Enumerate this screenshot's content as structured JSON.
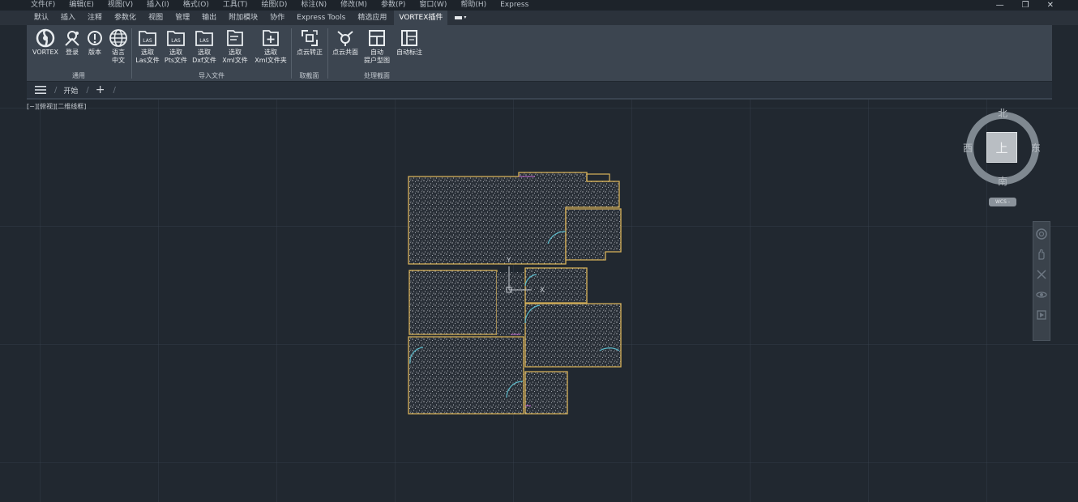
{
  "menu": [
    "文件(F)",
    "编辑(E)",
    "视图(V)",
    "插入(I)",
    "格式(O)",
    "工具(T)",
    "绘图(D)",
    "标注(N)",
    "修改(M)",
    "参数(P)",
    "窗口(W)",
    "帮助(H)",
    "Express"
  ],
  "window_controls": {
    "minimize": "—",
    "restore": "❐",
    "close": "✕"
  },
  "tabs": [
    "默认",
    "插入",
    "注释",
    "参数化",
    "视图",
    "管理",
    "输出",
    "附加模块",
    "协作",
    "Express Tools",
    "精选应用",
    "VORTEX插件"
  ],
  "active_tab": "VORTEX插件",
  "ribbon": {
    "groups": [
      {
        "title": "通用",
        "buttons": [
          {
            "label": "VORTEX",
            "icon": "vortex-logo-icon"
          },
          {
            "label": "登录",
            "icon": "login-icon"
          },
          {
            "label": "版本",
            "icon": "version-icon"
          },
          {
            "label": "语言\n中文",
            "icon": "globe-icon"
          }
        ]
      },
      {
        "title": "导入文件",
        "buttons": [
          {
            "label": "选取\nLas文件",
            "icon": "las-file-icon"
          },
          {
            "label": "选取\nPts文件",
            "icon": "pts-file-icon"
          },
          {
            "label": "选取\nDxf文件",
            "icon": "dxf-file-icon"
          },
          {
            "label": "选取\nXml文件",
            "icon": "xml-file-icon"
          },
          {
            "label": "选取\nXml文件夹",
            "icon": "xml-folder-icon"
          }
        ]
      },
      {
        "title": "取截面",
        "buttons": [
          {
            "label": "点云转正",
            "icon": "pointcloud-align-icon"
          }
        ]
      },
      {
        "title": "处理截面",
        "buttons": [
          {
            "label": "点云共面",
            "icon": "pointcloud-coplanar-icon"
          },
          {
            "label": "自动\n提户型图",
            "icon": "floorplan-icon"
          },
          {
            "label": "自动标注",
            "icon": "auto-dimension-icon"
          }
        ]
      }
    ]
  },
  "file_tabs": {
    "start": "开始",
    "add": "+"
  },
  "viewport": {
    "label": "[−][俯视][二维线框]",
    "compass": {
      "north": "北",
      "south": "南",
      "east": "东",
      "west": "西",
      "face": "上"
    },
    "wcs": "WCS -"
  },
  "colors": {
    "background": "#212830",
    "ribbon": "#3c4550",
    "wall": "#d9b35a",
    "door": "#5bb8c8"
  }
}
